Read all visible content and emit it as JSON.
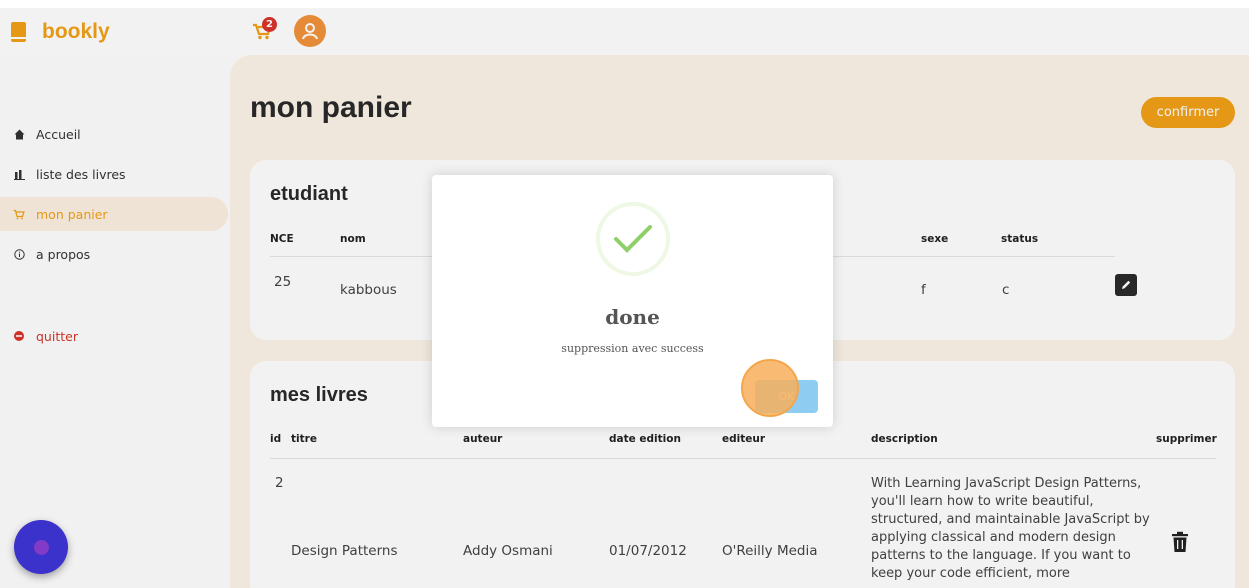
{
  "app": {
    "name": "bookly"
  },
  "header": {
    "cart_count": "2"
  },
  "sidebar": {
    "items": [
      {
        "label": "Accueil",
        "icon": "home-icon"
      },
      {
        "label": "liste des livres",
        "icon": "chart-bar-icon"
      },
      {
        "label": "mon panier",
        "icon": "cart-icon",
        "active": true
      },
      {
        "label": "a propos",
        "icon": "info-icon"
      },
      {
        "label": "quitter",
        "icon": "minus-circle-icon"
      }
    ]
  },
  "main": {
    "title": "mon panier",
    "confirm_label": "confirmer",
    "student": {
      "title": "etudiant",
      "headers": {
        "nce": "NCE",
        "nom": "nom",
        "sexe": "sexe",
        "status": "status"
      },
      "row": {
        "nce": "25",
        "nom": "kabbous",
        "sexe": "f",
        "status": "c"
      }
    },
    "books": {
      "title": "mes livres",
      "headers": {
        "id": "id",
        "titre": "titre",
        "auteur": "auteur",
        "date": "date edition",
        "editeur": "editeur",
        "description": "description",
        "supprimer": "supprimer"
      },
      "row": {
        "id": "2",
        "titre": "Design Patterns",
        "auteur": "Addy Osmani",
        "date": "01/07/2012",
        "editeur": "O'Reilly Media",
        "description": "With Learning JavaScript Design Patterns, you'll learn how to write beautiful, structured, and maintainable JavaScript by applying classical and modern design patterns to the language. If you want to keep your code efficient, more"
      }
    }
  },
  "dialog": {
    "title": "done",
    "message": "suppression avec success",
    "ok_label": "OK"
  },
  "colors": {
    "accent": "#f2a118",
    "danger": "#d9342b",
    "ok_button": "#8ecdf1"
  }
}
